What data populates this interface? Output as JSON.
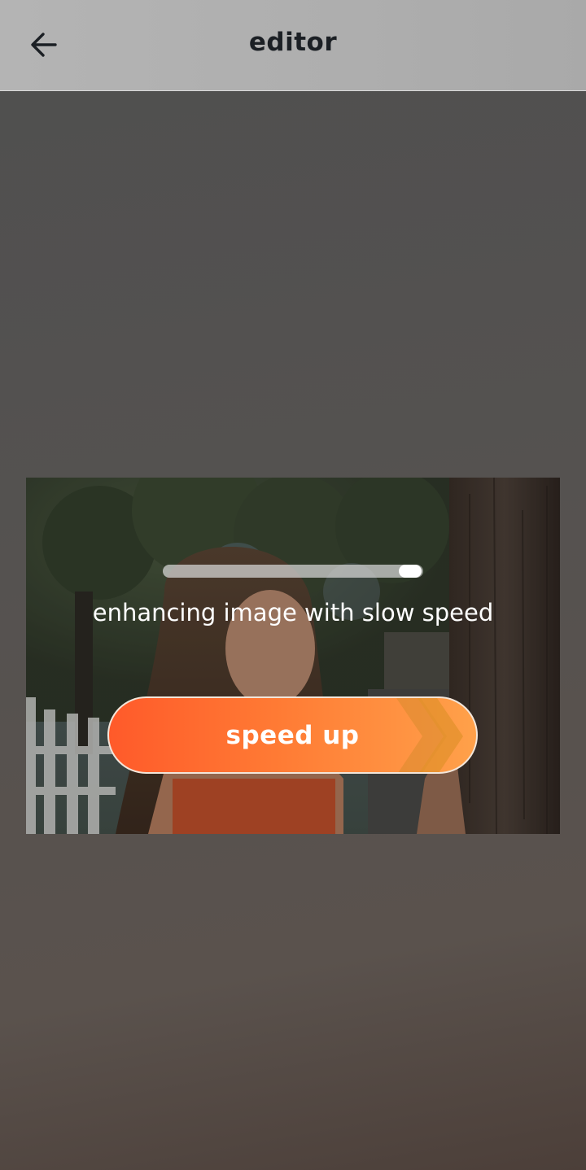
{
  "header": {
    "title": "editor",
    "back_icon": "arrow-left-icon"
  },
  "enhance": {
    "progress": 0.95,
    "status_text": "enhancing image with slow speed",
    "speed_up_label": "speed up",
    "button_icon": "double-chevron-right-icon"
  },
  "colors": {
    "accent_start": "#ff5a2a",
    "accent_end": "#ffa14a",
    "header_bg": "#b0b0b0",
    "background": "#535150"
  }
}
